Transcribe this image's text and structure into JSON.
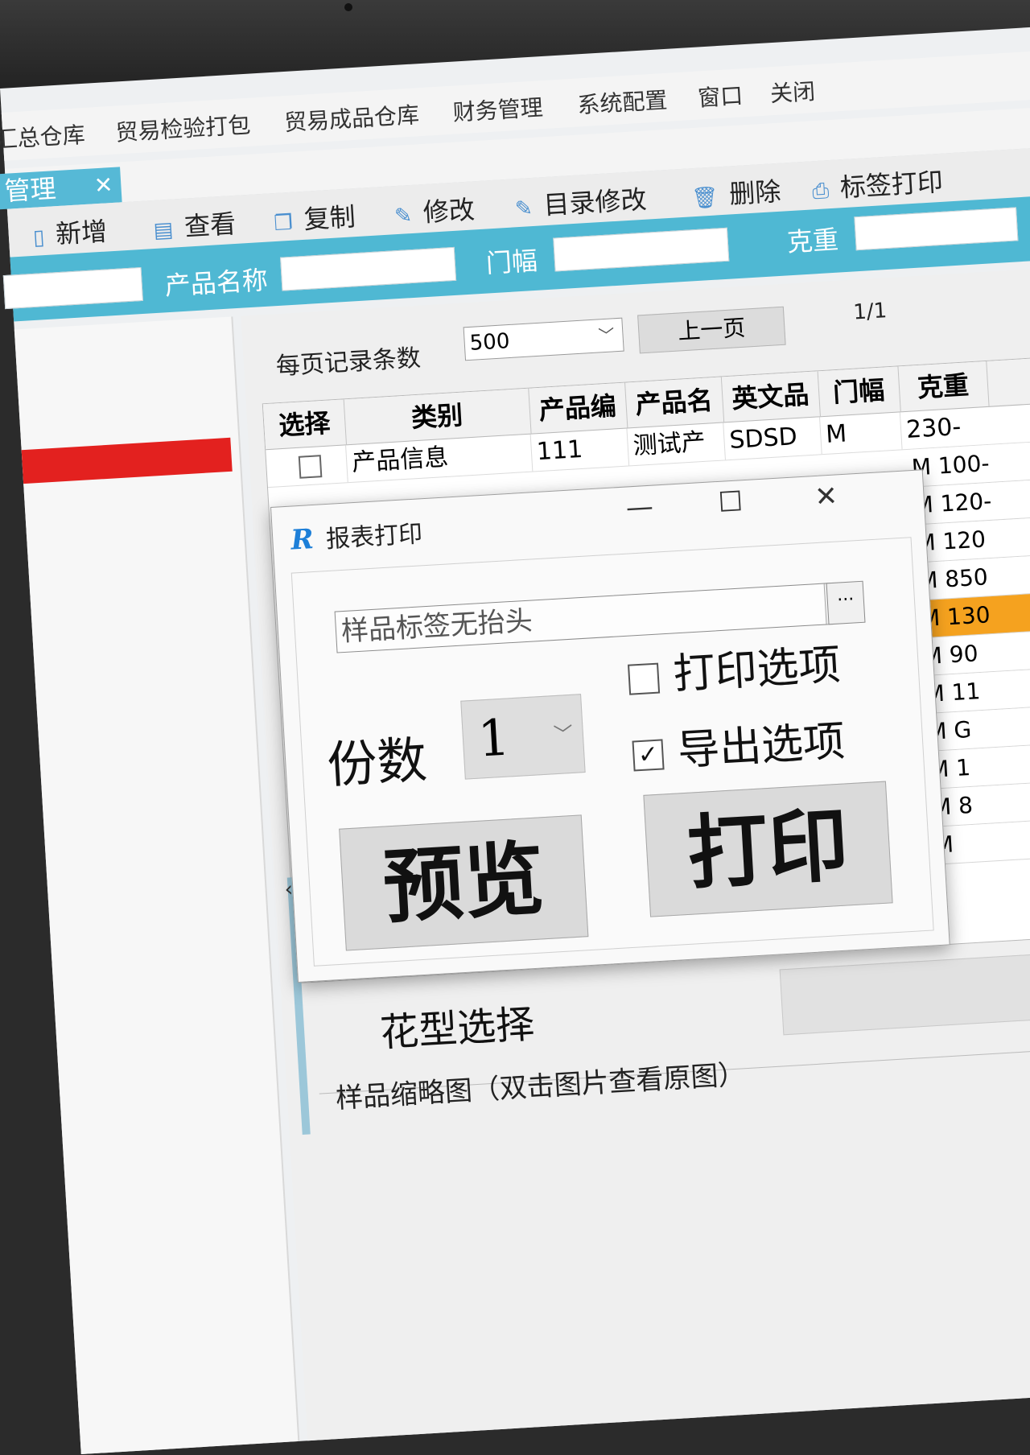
{
  "menubar": {
    "items": [
      "汇总仓库",
      "贸易检验打包",
      "贸易成品仓库",
      "财务管理",
      "系统配置",
      "窗口",
      "关闭"
    ]
  },
  "tab": {
    "label": "管理",
    "close": "✕"
  },
  "toolbar": {
    "add": "新增",
    "view": "查看",
    "copy": "复制",
    "edit": "修改",
    "catalog_edit": "目录修改",
    "delete": "删除",
    "label_print": "标签打印"
  },
  "filters": {
    "product_name": "产品名称",
    "width": "门幅",
    "weight": "克重"
  },
  "pager": {
    "per_page_label": "每页记录条数",
    "per_page_value": "500",
    "prev": "上一页",
    "page_info": "1/1"
  },
  "grid": {
    "headers": [
      "选择",
      "类别",
      "产品编",
      "产品名",
      "英文品",
      "门幅",
      "克重"
    ],
    "row1": {
      "category": "产品信息",
      "code": "111",
      "name": "测试产",
      "en": "SDSD",
      "weight": "230-"
    },
    "right_values": [
      "M 100-",
      "M 120-",
      "M 120",
      "M 850",
      "M 130",
      "M 90",
      "M 11",
      "M G",
      "M 1",
      "M 8",
      "M"
    ],
    "highlight_index": 4
  },
  "bottom": {
    "pattern_label": "花型选择",
    "thumbnail_title": "样品缩略图（双击图片查看原图）"
  },
  "dialog": {
    "title": "报表打印",
    "minimize": "—",
    "maximize": "☐",
    "close": "✕",
    "template": "样品标签无抬头",
    "more": "···",
    "copies_label": "份数",
    "copies_value": "1",
    "print_option": "打印选项",
    "print_option_checked": false,
    "export_option": "导出选项",
    "export_option_checked": true,
    "preview": "预览",
    "print": "打印"
  },
  "colors": {
    "accent": "#4fb8d3",
    "highlight": "#f5a21f",
    "marker": "#e3211f"
  }
}
